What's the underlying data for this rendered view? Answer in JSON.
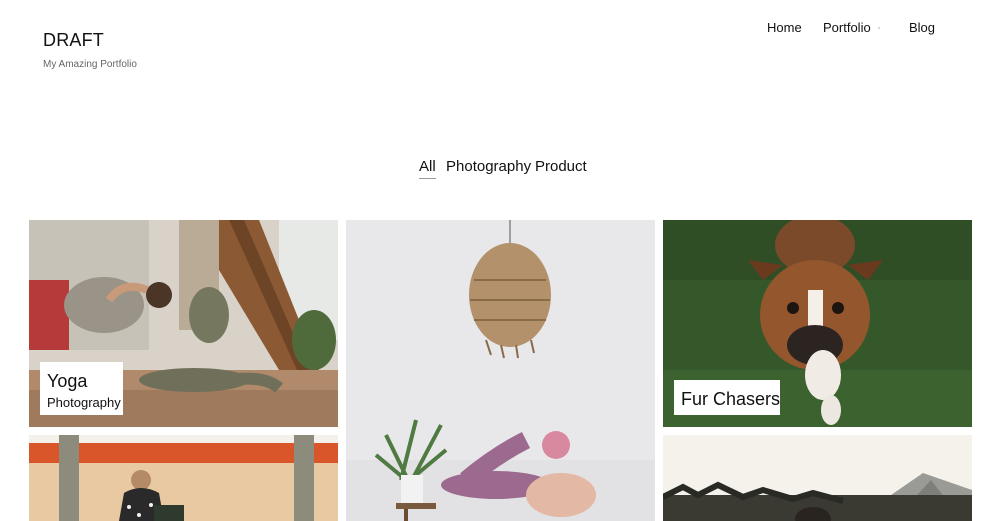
{
  "site": {
    "title": "DRAFT",
    "tagline": "My Amazing Portfolio"
  },
  "nav": {
    "items": [
      "Home",
      "Portfolio",
      "Blog"
    ]
  },
  "filters": {
    "items": [
      "All",
      "Photography",
      "Product"
    ],
    "active": "All"
  },
  "portfolio": {
    "items": [
      {
        "title": "Yoga",
        "category": "Photography",
        "image": "yoga-pose-indoors"
      },
      {
        "title": "",
        "category": "",
        "image": "pendant-lamp-yoga"
      },
      {
        "title": "Fur Chasers",
        "category": "",
        "image": "boxer-dog-on-grass"
      },
      {
        "title": "",
        "category": "",
        "image": "woman-with-shopping-bag"
      },
      {
        "title": "",
        "category": "",
        "image": "mountain-landscape"
      }
    ]
  },
  "colors": {
    "text": "#111111",
    "tagline": "#666666",
    "background": "#ffffff"
  }
}
